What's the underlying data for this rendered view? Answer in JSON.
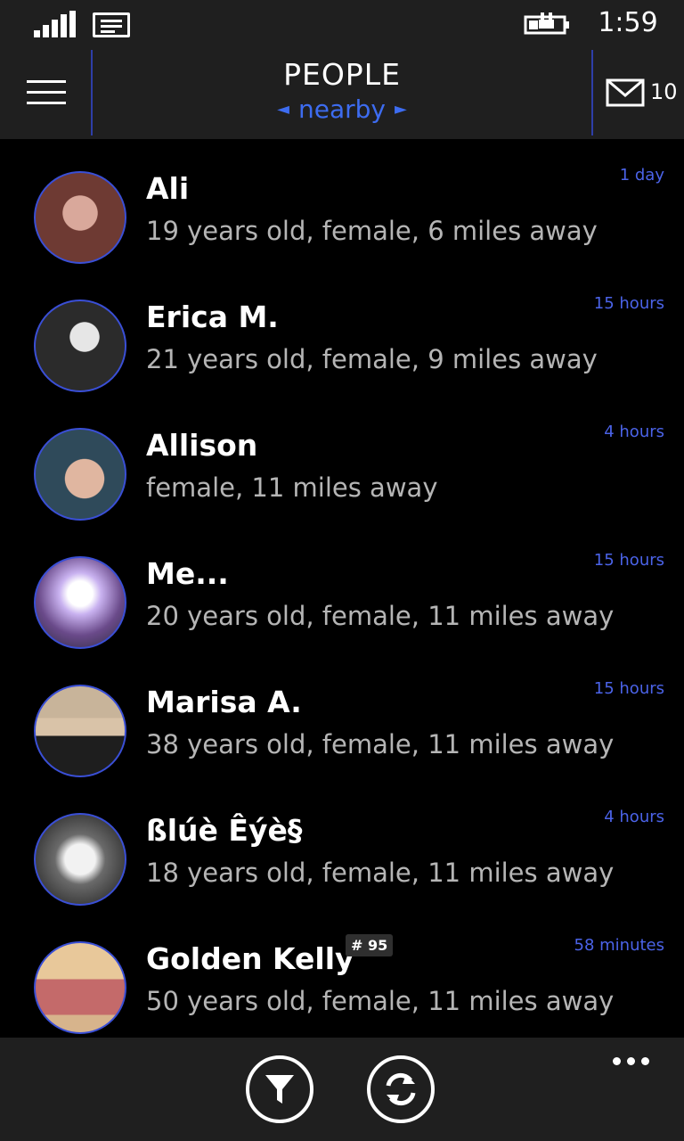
{
  "status_bar": {
    "time": "1:59",
    "icons": [
      "signal-strength-icon",
      "message-icon",
      "battery-charging-icon"
    ]
  },
  "header": {
    "title": "PEOPLE",
    "subtitle": "nearby",
    "menu_icon": "hamburger-icon",
    "mail_icon": "mail-icon",
    "mail_count": "10"
  },
  "people": [
    {
      "name": "Ali",
      "detail": "19 years old, female, 6 miles away",
      "time": "1 day",
      "avatar_color": "#7a4a44"
    },
    {
      "name": "Erica M.",
      "detail": "21 years old, female, 9 miles away",
      "time": "15 hours",
      "avatar_color": "#8c8c8c"
    },
    {
      "name": "Allison",
      "detail": "female, 11 miles away",
      "time": "4 hours",
      "avatar_color": "#5a8aa6"
    },
    {
      "name": "Me...",
      "detail": "20 years old, female, 11 miles away",
      "time": "15 hours",
      "avatar_color": "#b9a7d8"
    },
    {
      "name": "Marisa A.",
      "detail": "38 years old, female, 11 miles away",
      "time": "15 hours",
      "avatar_color": "#a28e74"
    },
    {
      "name": "ßlúè Êýè§",
      "detail": "18 years old, female, 11 miles away",
      "time": "4 hours",
      "avatar_color": "#9a9a9a"
    },
    {
      "name": "Golden Kelly",
      "detail": "50 years old, female, 11 miles away",
      "time": "58 minutes",
      "avatar_color": "#b88a6a",
      "rank": "# 95"
    }
  ],
  "app_bar": {
    "buttons": [
      "filter-icon",
      "refresh-icon"
    ],
    "more_icon": "more-options-icon"
  },
  "colors": {
    "accent": "#3d6cf0",
    "time_text": "#4b63e8",
    "bar_bg": "#1f1f1f",
    "detail_text": "#b5b5b5"
  }
}
